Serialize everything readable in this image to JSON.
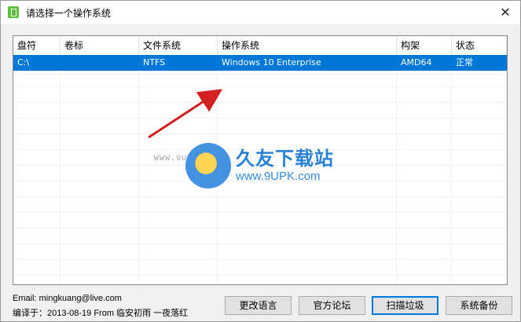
{
  "window": {
    "title": "请选择一个操作系统",
    "close_glyph": "✕"
  },
  "table": {
    "headers": [
      "盘符",
      "卷标",
      "文件系统",
      "操作系统",
      "构架",
      "状态"
    ],
    "rows": [
      {
        "drive": "C:\\",
        "label": "",
        "fs": "NTFS",
        "os": "Windows 10 Enterprise",
        "arch": "AMD64",
        "status": "正常",
        "selected": true
      }
    ]
  },
  "watermark": {
    "title": "久友下载站",
    "url": "www.9UPK.com",
    "small": "WWW.9UPK.COM"
  },
  "footer": {
    "email": "Email: mingkuang@live.com",
    "compiled": "编译于：2013-08-19 From 临安初雨 一夜落红"
  },
  "buttons": {
    "language": "更改语言",
    "forum": "官方论坛",
    "scan": "扫描垃圾",
    "backup": "系统备份"
  },
  "colors": {
    "selection": "#0078d7",
    "arrow": "#d42020"
  }
}
